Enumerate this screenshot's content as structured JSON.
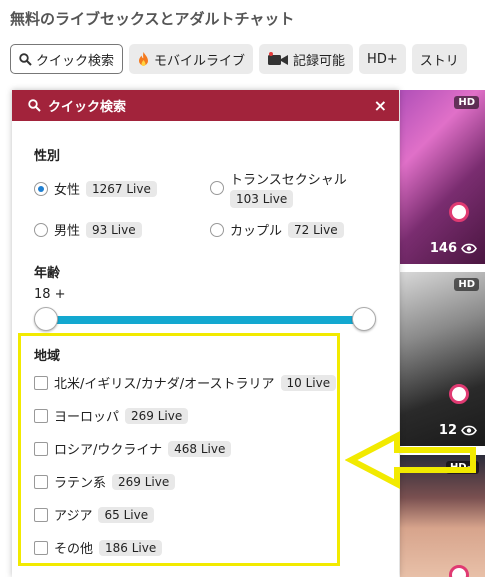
{
  "page": {
    "title": "無料のライブセックスとアダルトチャット"
  },
  "tabs": [
    {
      "label": "クイック検索",
      "icon": "search-icon",
      "active": true
    },
    {
      "label": "モバイルライブ",
      "icon": "fire-icon"
    },
    {
      "label": "記録可能",
      "icon": "video-camera-icon"
    },
    {
      "label": "HD+"
    },
    {
      "label": "ストリ"
    }
  ],
  "panel": {
    "title": "クイック検索",
    "close": "×",
    "gender": {
      "label": "性別",
      "options": [
        {
          "label": "女性",
          "count": "1267 Live",
          "checked": true
        },
        {
          "label": "トランスセクシャル",
          "count": "103 Live"
        },
        {
          "label": "男性",
          "count": "93 Live"
        },
        {
          "label": "カップル",
          "count": "72 Live"
        }
      ]
    },
    "age": {
      "label": "年齢",
      "value": "18 +"
    },
    "region": {
      "label": "地域",
      "options": [
        {
          "label": "北米/イギリス/カナダ/オーストラリア",
          "count": "10 Live"
        },
        {
          "label": "ヨーロッパ",
          "count": "269 Live"
        },
        {
          "label": "ロシア/ウクライナ",
          "count": "468 Live"
        },
        {
          "label": "ラテン系",
          "count": "269 Live"
        },
        {
          "label": "アジア",
          "count": "65 Live"
        },
        {
          "label": "その他",
          "count": "186 Live"
        }
      ]
    }
  },
  "thumbnails": [
    {
      "badge": "HD",
      "viewers": "146"
    },
    {
      "badge": "HD",
      "viewers": "12"
    },
    {
      "badge": "HD+"
    }
  ],
  "colors": {
    "panel_header": "#a2233b",
    "slider": "#13a8d0",
    "highlight": "#f2ea00",
    "radio_checked": "#1f7fd1"
  }
}
